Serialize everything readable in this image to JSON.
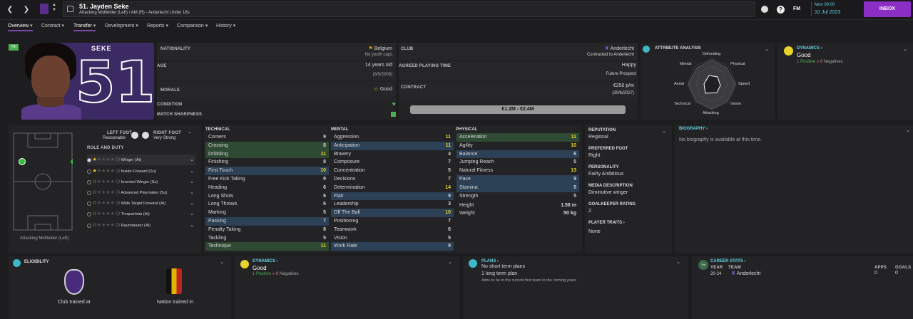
{
  "header": {
    "title": "51. Jayden Seke",
    "subtitle": "Attacking Midfielder (Left) / AM (R) - Anderlecht Under 18s",
    "date_day": "Mon 09:00",
    "date": "10 Jul 2023",
    "inbox": "INBOX",
    "fm": "FM"
  },
  "tabs": [
    "Overview",
    "Contract",
    "Transfer",
    "Development",
    "Reports",
    "Comparison",
    "History"
  ],
  "player": {
    "shirt_name": "SEKE",
    "shirt_number": "51",
    "badge": "Yth"
  },
  "info": {
    "nationality_label": "NATIONALITY",
    "nationality": "Belgium",
    "youth_caps": "No youth caps",
    "age_label": "AGE",
    "age": "14 years old",
    "dob": "(8/5/2009)",
    "morale_label": "MORALE",
    "morale": "Good",
    "condition_label": "CONDITION",
    "sharpness_label": "MATCH SHARPNESS",
    "club_label": "CLUB",
    "club": "Anderlecht",
    "contracted": "Contracted to Anderlecht",
    "apt_label": "AGREED PLAYING TIME",
    "apt": "Happy",
    "apt_sub": "Future Prospect",
    "contract_label": "CONTRACT",
    "wage": "€250 p/m",
    "expiry": "(30/6/2027)",
    "value": "€1.2M - €2.4M"
  },
  "attr_analysis": {
    "title": "ATTRIBUTE ANALYSIS",
    "labels": [
      "Defending",
      "Physical",
      "Speed",
      "Vision",
      "Attacking",
      "Technical",
      "Aerial",
      "Mental"
    ]
  },
  "dynamics_top": {
    "title": "DYNAMICS",
    "status": "Good",
    "positive": "1 Positive",
    "negative": "0 Negatives"
  },
  "feet": {
    "left_label": "LEFT FOOT",
    "left": "Reasonable",
    "right_label": "RIGHT FOOT",
    "right": "Very Strong"
  },
  "roles_title": "ROLE AND DUTY",
  "roles": [
    {
      "name": "Winger (At)",
      "stars": 1.5
    },
    {
      "name": "Inside Forward (Su)",
      "stars": 1.5
    },
    {
      "name": "Inverted Winger (Su)",
      "stars": 1
    },
    {
      "name": "Advanced Playmaker (Su)",
      "stars": 1
    },
    {
      "name": "Wide Target Forward (At)",
      "stars": 1
    },
    {
      "name": "Trequartista (At)",
      "stars": 1
    },
    {
      "name": "Raumdeuter (At)",
      "stars": 1
    }
  ],
  "position_label": "Attacking Midfielder (Left)",
  "technical": {
    "title": "TECHNICAL",
    "rows": [
      {
        "n": "Corners",
        "v": "9",
        "h": ""
      },
      {
        "n": "Crossing",
        "v": "8",
        "h": "g"
      },
      {
        "n": "Dribbling",
        "v": "11",
        "h": "g"
      },
      {
        "n": "Finishing",
        "v": "8",
        "h": ""
      },
      {
        "n": "First Touch",
        "v": "10",
        "h": "b"
      },
      {
        "n": "Free Kick Taking",
        "v": "9",
        "h": ""
      },
      {
        "n": "Heading",
        "v": "6",
        "h": ""
      },
      {
        "n": "Long Shots",
        "v": "6",
        "h": ""
      },
      {
        "n": "Long Throws",
        "v": "6",
        "h": ""
      },
      {
        "n": "Marking",
        "v": "5",
        "h": ""
      },
      {
        "n": "Passing",
        "v": "7",
        "h": "b"
      },
      {
        "n": "Penalty Taking",
        "v": "8",
        "h": ""
      },
      {
        "n": "Tackling",
        "v": "5",
        "h": ""
      },
      {
        "n": "Technique",
        "v": "11",
        "h": "g"
      }
    ]
  },
  "mental": {
    "title": "MENTAL",
    "rows": [
      {
        "n": "Aggression",
        "v": "11",
        "h": ""
      },
      {
        "n": "Anticipation",
        "v": "11",
        "h": "b"
      },
      {
        "n": "Bravery",
        "v": "4",
        "h": ""
      },
      {
        "n": "Composure",
        "v": "7",
        "h": ""
      },
      {
        "n": "Concentration",
        "v": "5",
        "h": ""
      },
      {
        "n": "Decisions",
        "v": "7",
        "h": ""
      },
      {
        "n": "Determination",
        "v": "14",
        "h": ""
      },
      {
        "n": "Flair",
        "v": "9",
        "h": "b"
      },
      {
        "n": "Leadership",
        "v": "3",
        "h": ""
      },
      {
        "n": "Off The Ball",
        "v": "10",
        "h": "b"
      },
      {
        "n": "Positioning",
        "v": "7",
        "h": ""
      },
      {
        "n": "Teamwork",
        "v": "6",
        "h": ""
      },
      {
        "n": "Vision",
        "v": "5",
        "h": ""
      },
      {
        "n": "Work Rate",
        "v": "9",
        "h": "b"
      }
    ]
  },
  "physical": {
    "title": "PHYSICAL",
    "rows": [
      {
        "n": "Acceleration",
        "v": "11",
        "h": "g"
      },
      {
        "n": "Agility",
        "v": "10",
        "h": ""
      },
      {
        "n": "Balance",
        "v": "6",
        "h": "b"
      },
      {
        "n": "Jumping Reach",
        "v": "5",
        "h": ""
      },
      {
        "n": "Natural Fitness",
        "v": "13",
        "h": ""
      },
      {
        "n": "Pace",
        "v": "9",
        "h": "b"
      },
      {
        "n": "Stamina",
        "v": "5",
        "h": "b"
      },
      {
        "n": "Strength",
        "v": "5",
        "h": ""
      }
    ],
    "height_label": "Height",
    "height": "1.58 m",
    "weight_label": "Weight",
    "weight": "50 kg"
  },
  "details": {
    "reputation_label": "REPUTATION",
    "reputation": "Regional",
    "pref_foot_label": "PREFERRED FOOT",
    "pref_foot": "Right",
    "personality_label": "PERSONALITY",
    "personality": "Fairly Ambitious",
    "media_label": "MEDIA DESCRIPTION",
    "media": "Diminutive winger",
    "gk_label": "GOALKEEPER RATING",
    "gk": "2",
    "traits_label": "PLAYER TRAITS",
    "traits": "None"
  },
  "biography": {
    "title": "BIOGRAPHY",
    "text": "No biography is available at this time."
  },
  "eligibility": {
    "title": "ELIGIBILITY",
    "club": "Club trained at",
    "nation": "Nation trained in"
  },
  "dynamics_bottom": {
    "title": "DYNAMICS",
    "status": "Good",
    "positive": "1 Positive",
    "negative": "0 Negatives"
  },
  "plans": {
    "title": "PLANS",
    "line1": "No short term plans",
    "line2": "1 long term plan",
    "line3": "Aims to be in the current first team in the coming years"
  },
  "career": {
    "title": "CAREER STATS",
    "year_h": "YEAR",
    "team_h": "TEAM",
    "apps_h": "APPS",
    "goals_h": "GOALS",
    "year": "20-24",
    "team": "Anderlecht",
    "apps": "0",
    "goals": "0"
  }
}
